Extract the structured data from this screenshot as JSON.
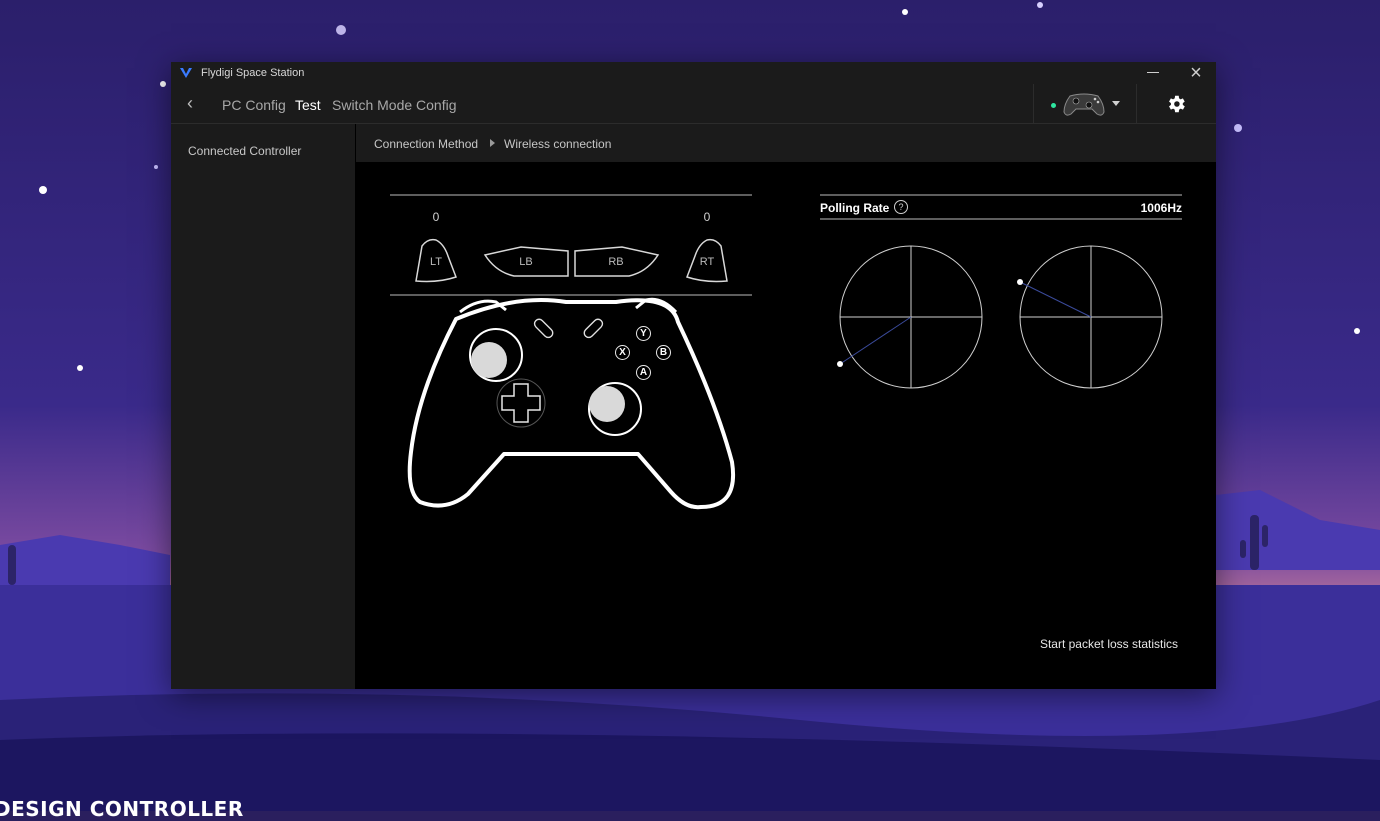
{
  "window": {
    "title": "Flydigi Space Station"
  },
  "nav": {
    "back_label": "‹",
    "tabs": [
      {
        "label": "PC Config",
        "active": false
      },
      {
        "label": "Test",
        "active": true
      },
      {
        "label": "Switch Mode Config",
        "active": false
      }
    ],
    "device_status_color": "#2ee6a0"
  },
  "sidebar": {
    "items": [
      {
        "label": "Connected Controller"
      }
    ]
  },
  "breadcrumb": {
    "label": "Connection Method",
    "value": "Wireless connection"
  },
  "controller": {
    "lt_value": "0",
    "rt_value": "0",
    "labels": {
      "lt": "LT",
      "lb": "LB",
      "rb": "RB",
      "rt": "RT"
    },
    "face_buttons": {
      "y": "Y",
      "x": "X",
      "b": "B",
      "a": "A"
    }
  },
  "polling": {
    "label": "Polling Rate",
    "help": "?",
    "value": "1006Hz"
  },
  "packet_loss": {
    "label": "Start packet loss statistics"
  },
  "caption": {
    "text": "DESIGN CONTROLLER"
  }
}
